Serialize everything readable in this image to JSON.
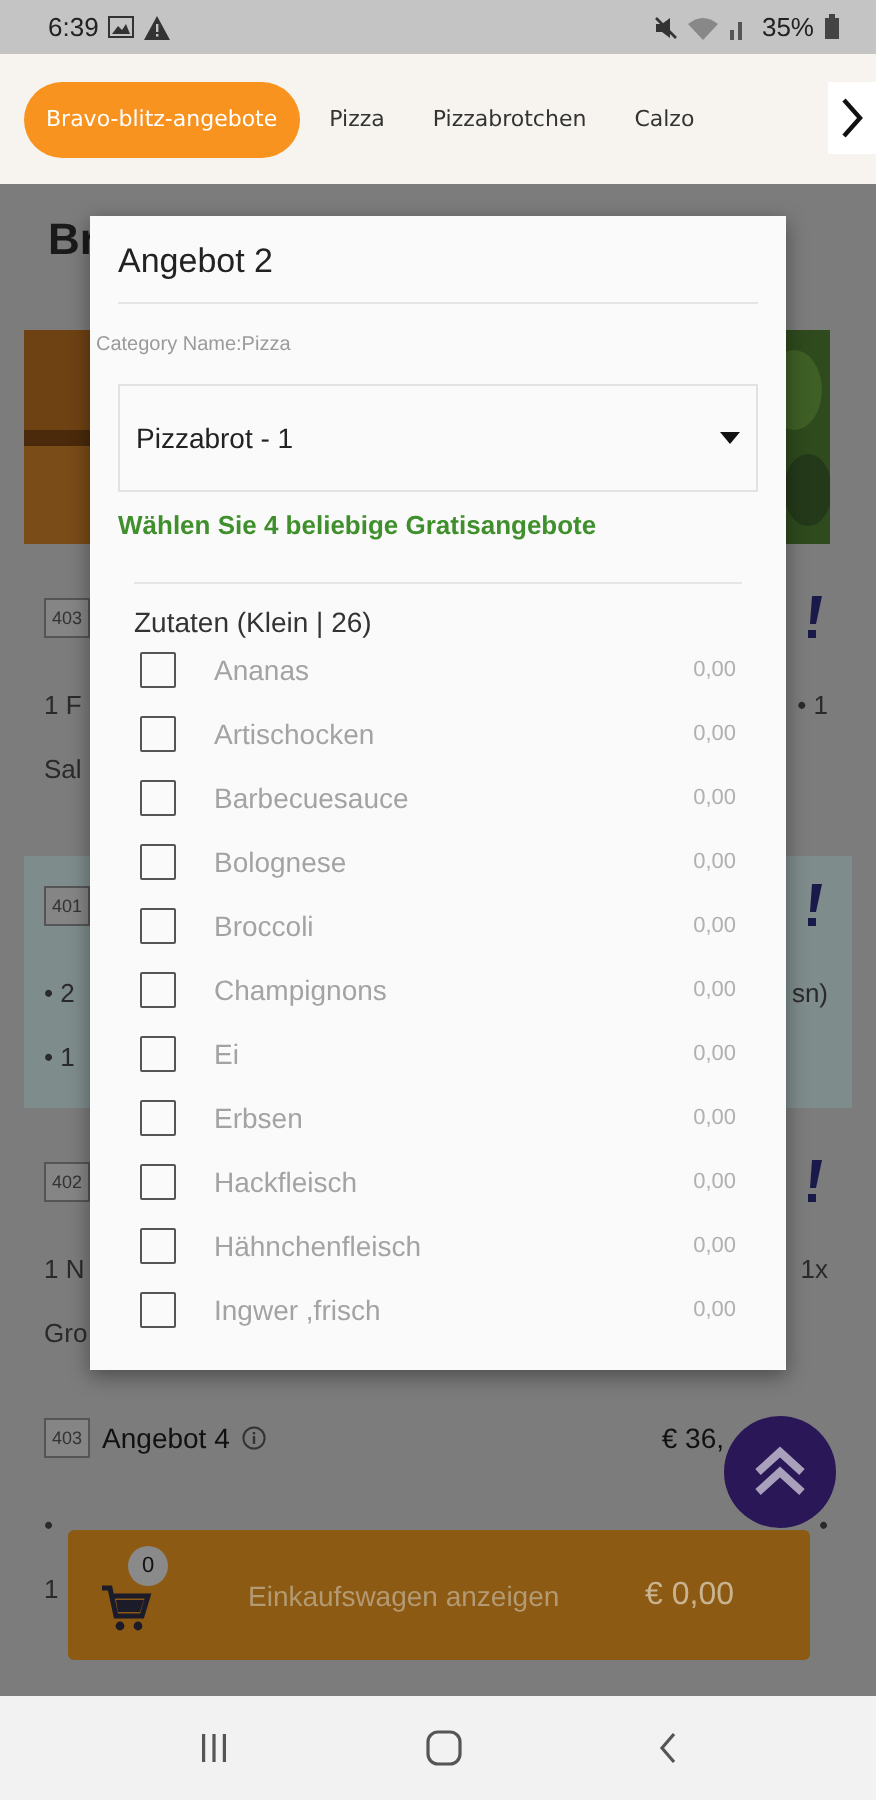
{
  "status_bar": {
    "time": "6:39",
    "battery": "35%"
  },
  "tabs": [
    {
      "label": "Bravo-blitz-angebote",
      "selected": true
    },
    {
      "label": "Pizza",
      "selected": false
    },
    {
      "label": "Pizzabrotchen",
      "selected": false
    },
    {
      "label": "Calzo",
      "selected": false
    }
  ],
  "page": {
    "heading": "Br",
    "items": [
      {
        "code": "403",
        "lines": [
          "1 F",
          "Sal"
        ],
        "right_lines": [
          "• 1"
        ],
        "highlighted": false
      },
      {
        "code": "401",
        "lines": [
          "• 2",
          "• 1"
        ],
        "right_lines": [
          "sn)"
        ],
        "highlighted": true
      },
      {
        "code": "402",
        "lines": [
          "1 N",
          "Gro"
        ],
        "right_lines": [
          "1x"
        ],
        "highlighted": false
      },
      {
        "code": "403",
        "name": "Angebot 4",
        "price": "€ 36,",
        "lines": [
          "•",
          "1"
        ],
        "right_lines": [
          "•"
        ],
        "highlighted": false
      }
    ]
  },
  "dialog": {
    "title": "Angebot 2",
    "category": "Category Name:Pizza",
    "select_value": "Pizzabrot - 1",
    "hint": "Wählen Sie 4 beliebige Gratisangebote",
    "group": "Zutaten (Klein | 26)",
    "options": [
      {
        "name": "Ananas",
        "price": "0,00",
        "checked": false
      },
      {
        "name": "Artischocken",
        "price": "0,00",
        "checked": false
      },
      {
        "name": "Barbecuesauce",
        "price": "0,00",
        "checked": false
      },
      {
        "name": "Bolognese",
        "price": "0,00",
        "checked": false
      },
      {
        "name": "Broccoli",
        "price": "0,00",
        "checked": false
      },
      {
        "name": "Champignons",
        "price": "0,00",
        "checked": false
      },
      {
        "name": "Ei",
        "price": "0,00",
        "checked": false
      },
      {
        "name": "Erbsen",
        "price": "0,00",
        "checked": false
      },
      {
        "name": "Hackfleisch",
        "price": "0,00",
        "checked": false
      },
      {
        "name": "Hähnchenfleisch",
        "price": "0,00",
        "checked": false
      },
      {
        "name": "Ingwer ,frisch",
        "price": "0,00",
        "checked": false
      }
    ]
  },
  "cart": {
    "count": "0",
    "label": "Einkaufswagen anzeigen",
    "total": "€ 0,00"
  }
}
